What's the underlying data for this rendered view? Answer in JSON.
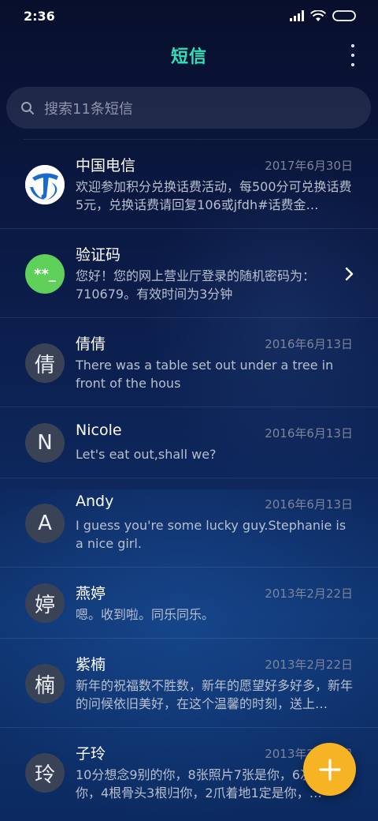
{
  "status_bar": {
    "time": "2:36"
  },
  "header": {
    "title": "短信"
  },
  "search": {
    "placeholder": "搜索11条短信"
  },
  "conversations": [
    {
      "name": "中国电信",
      "date": "2017年6月30日",
      "preview": "欢迎参加积分兑换话费活动，每500分可兑换话费5元，兑换话费请回复106或jfdh#话费金…",
      "avatar": "telecom-logo"
    },
    {
      "name": "验证码",
      "date": "",
      "preview": "您好！您的网上营业厅登录的随机密码为：710679。有效时间为3分钟",
      "avatar_text": "**_"
    },
    {
      "name": "倩倩",
      "date": "2016年6月13日",
      "preview": "There was a table set out under a tree in front of the hous",
      "avatar_text": "倩"
    },
    {
      "name": "Nicole",
      "date": "2016年6月13日",
      "preview": "Let's eat out,shall we?",
      "avatar_text": "N"
    },
    {
      "name": "Andy",
      "date": "2016年6月13日",
      "preview": "I guess you're some lucky guy.Stephanie is a nice girl.",
      "avatar_text": "A"
    },
    {
      "name": "燕婷",
      "date": "2013年2月22日",
      "preview": "嗯。收到啦。同乐同乐。",
      "avatar_text": "婷"
    },
    {
      "name": "紫楠",
      "date": "2013年2月22日",
      "preview": "新年的祝福数不胜数，新年的愿望好多好多，新年的问候依旧美好，在这个温馨的时刻，送上…",
      "avatar_text": "楠"
    },
    {
      "name": "子玲",
      "date": "2013年2月22日",
      "preview": "10分想念9别的你，8张照片7张是你，6次…只像你，4根骨头3根归你，2爪着地1定是你，…",
      "avatar_text": "玲"
    }
  ],
  "colors": {
    "accent": "#2fe0b8",
    "fab": "#f6b324",
    "telecom_blue": "#1a6bd0",
    "verify_green": "#5fd05a"
  }
}
